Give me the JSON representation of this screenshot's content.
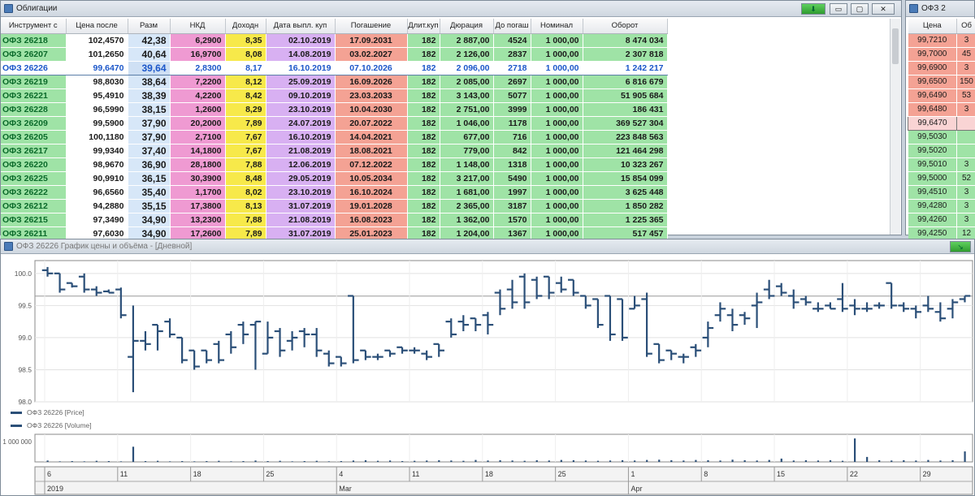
{
  "bonds_window": {
    "title": "Облигации",
    "columns": [
      "Инструмент с",
      "Цена после",
      "Разм",
      "НКД",
      "Доходн",
      "Дата выпл. куп",
      "Погашение",
      "Длит.куп",
      "Дюрация",
      "До погаш",
      "Номинал",
      "Оборот"
    ],
    "rows": [
      [
        "ОФЗ 26218",
        "102,4570",
        "42,38",
        "6,2900",
        "8,35",
        "02.10.2019",
        "17.09.2031",
        "182",
        "2 887,00",
        "4524",
        "1 000,00",
        "8 474 034"
      ],
      [
        "ОФЗ 26207",
        "101,2650",
        "40,64",
        "16,9700",
        "8,08",
        "14.08.2019",
        "03.02.2027",
        "182",
        "2 126,00",
        "2837",
        "1 000,00",
        "2 307 818"
      ],
      [
        "ОФЗ 26226",
        "99,6470",
        "39,64",
        "2,8300",
        "8,17",
        "16.10.2019",
        "07.10.2026",
        "182",
        "2 096,00",
        "2718",
        "1 000,00",
        "1 242 217"
      ],
      [
        "ОФЗ 26219",
        "98,8030",
        "38,64",
        "7,2200",
        "8,12",
        "25.09.2019",
        "16.09.2026",
        "182",
        "2 085,00",
        "2697",
        "1 000,00",
        "6 816 679"
      ],
      [
        "ОФЗ 26221",
        "95,4910",
        "38,39",
        "4,2200",
        "8,42",
        "09.10.2019",
        "23.03.2033",
        "182",
        "3 143,00",
        "5077",
        "1 000,00",
        "51 905 684"
      ],
      [
        "ОФЗ 26228",
        "96,5990",
        "38,15",
        "1,2600",
        "8,29",
        "23.10.2019",
        "10.04.2030",
        "182",
        "2 751,00",
        "3999",
        "1 000,00",
        "186 431"
      ],
      [
        "ОФЗ 26209",
        "99,5900",
        "37,90",
        "20,2000",
        "7,89",
        "24.07.2019",
        "20.07.2022",
        "182",
        "1 046,00",
        "1178",
        "1 000,00",
        "369 527 304"
      ],
      [
        "ОФЗ 26205",
        "100,1180",
        "37,90",
        "2,7100",
        "7,67",
        "16.10.2019",
        "14.04.2021",
        "182",
        "677,00",
        "716",
        "1 000,00",
        "223 848 563"
      ],
      [
        "ОФЗ 26217",
        "99,9340",
        "37,40",
        "14,1800",
        "7,67",
        "21.08.2019",
        "18.08.2021",
        "182",
        "779,00",
        "842",
        "1 000,00",
        "121 464 298"
      ],
      [
        "ОФЗ 26220",
        "98,9670",
        "36,90",
        "28,1800",
        "7,88",
        "12.06.2019",
        "07.12.2022",
        "182",
        "1 148,00",
        "1318",
        "1 000,00",
        "10 323 267"
      ],
      [
        "ОФЗ 26225",
        "90,9910",
        "36,15",
        "30,3900",
        "8,48",
        "29.05.2019",
        "10.05.2034",
        "182",
        "3 217,00",
        "5490",
        "1 000,00",
        "15 854 099"
      ],
      [
        "ОФЗ 26222",
        "96,6560",
        "35,40",
        "1,1700",
        "8,02",
        "23.10.2019",
        "16.10.2024",
        "182",
        "1 681,00",
        "1997",
        "1 000,00",
        "3 625 448"
      ],
      [
        "ОФЗ 26212",
        "94,2880",
        "35,15",
        "17,3800",
        "8,13",
        "31.07.2019",
        "19.01.2028",
        "182",
        "2 365,00",
        "3187",
        "1 000,00",
        "1 850 282"
      ],
      [
        "ОФЗ 26215",
        "97,3490",
        "34,90",
        "13,2300",
        "7,88",
        "21.08.2019",
        "16.08.2023",
        "182",
        "1 362,00",
        "1570",
        "1 000,00",
        "1 225 365"
      ],
      [
        "ОФЗ 26211",
        "97,6030",
        "34,90",
        "17,2600",
        "7,89",
        "31.07.2019",
        "25.01.2023",
        "182",
        "1 204,00",
        "1367",
        "1 000,00",
        "517 457"
      ]
    ],
    "selected_row": 2,
    "toolbar_down_icon": "down-arrow-icon"
  },
  "orderbook_window": {
    "title": "ОФЗ 2",
    "columns": [
      "Цена",
      "Об"
    ],
    "rows": [
      [
        "99,7210",
        "3",
        "sell"
      ],
      [
        "99,7000",
        "45",
        "sell"
      ],
      [
        "99,6900",
        "3",
        "sell"
      ],
      [
        "99,6500",
        "150",
        "sell"
      ],
      [
        "99,6490",
        "53",
        "sell"
      ],
      [
        "99,6480",
        "3",
        "sell"
      ],
      [
        "99,6470",
        "",
        "current"
      ],
      [
        "99,5030",
        "",
        "buy"
      ],
      [
        "99,5020",
        "",
        "buy"
      ],
      [
        "99,5010",
        "3",
        "buy"
      ],
      [
        "99,5000",
        "52",
        "buy"
      ],
      [
        "99,4510",
        "3",
        "buy"
      ],
      [
        "99,4280",
        "3",
        "buy"
      ],
      [
        "99,4260",
        "3",
        "buy"
      ],
      [
        "99,4250",
        "12",
        "buy"
      ]
    ]
  },
  "chart_window": {
    "title": "ОФЗ 26226 График цены и объёма - [Дневной]",
    "legend_price": "ОФЗ 26226 [Price]",
    "legend_volume": "ОФЗ 26226 [Volume]",
    "volume_axis_label": "1 000 000",
    "date_labels": [
      "6",
      "11",
      "18",
      "25",
      "4",
      "11",
      "18",
      "25",
      "1",
      "8",
      "15",
      "22",
      "29"
    ],
    "month_labels": [
      "2019",
      "Mar",
      "Apr"
    ]
  },
  "chart_data": {
    "type": "ohlc",
    "yticks": [
      100.0,
      99.5,
      99.0,
      98.5,
      98.0
    ],
    "ylim": [
      98.0,
      100.2
    ],
    "current_price": 99.647,
    "series": [
      {
        "name": "ОФЗ 26226 [Price]",
        "bars": [
          [
            100.05,
            100.1,
            99.95,
            100.0
          ],
          [
            100.0,
            100.0,
            99.7,
            99.75
          ],
          [
            99.85,
            99.85,
            99.78,
            99.8
          ],
          [
            99.95,
            100.0,
            99.7,
            99.75
          ],
          [
            99.75,
            99.8,
            99.65,
            99.7
          ],
          [
            99.72,
            99.75,
            99.7,
            99.7
          ],
          [
            99.75,
            99.78,
            99.3,
            99.35
          ],
          [
            98.7,
            99.5,
            98.15,
            98.95
          ],
          [
            98.95,
            99.1,
            98.8,
            98.9
          ],
          [
            99.2,
            99.2,
            98.8,
            99.1
          ],
          [
            99.25,
            99.3,
            99.0,
            99.05
          ],
          [
            99.0,
            99.0,
            98.6,
            98.65
          ],
          [
            98.8,
            98.8,
            98.5,
            98.55
          ],
          [
            98.8,
            98.8,
            98.6,
            98.65
          ],
          [
            98.9,
            98.95,
            98.6,
            98.65
          ],
          [
            99.05,
            99.1,
            98.75,
            98.85
          ],
          [
            99.2,
            99.25,
            98.9,
            99.05
          ],
          [
            99.2,
            99.25,
            98.5,
            99.25
          ],
          [
            98.75,
            99.25,
            98.75,
            99.0
          ],
          [
            99.1,
            99.15,
            98.7,
            98.8
          ],
          [
            98.95,
            99.1,
            98.8,
            99.0
          ],
          [
            99.1,
            99.15,
            98.85,
            99.05
          ],
          [
            99.05,
            99.15,
            98.7,
            98.8
          ],
          [
            98.75,
            98.8,
            98.55,
            98.6
          ],
          [
            98.7,
            98.7,
            98.55,
            98.6
          ],
          [
            99.65,
            99.65,
            98.6,
            98.65
          ],
          [
            98.8,
            98.8,
            98.65,
            98.7
          ],
          [
            98.7,
            98.75,
            98.65,
            98.7
          ],
          [
            98.8,
            98.8,
            98.7,
            98.75
          ],
          [
            98.85,
            98.85,
            98.75,
            98.8
          ],
          [
            98.8,
            98.85,
            98.75,
            98.8
          ],
          [
            98.75,
            98.8,
            98.65,
            98.7
          ],
          [
            98.9,
            98.9,
            98.7,
            98.8
          ],
          [
            99.25,
            99.3,
            99.0,
            99.05
          ],
          [
            99.25,
            99.35,
            99.1,
            99.2
          ],
          [
            99.3,
            99.3,
            99.1,
            99.2
          ],
          [
            99.35,
            99.4,
            99.05,
            99.2
          ],
          [
            99.7,
            99.75,
            99.35,
            99.45
          ],
          [
            99.75,
            99.9,
            99.45,
            99.55
          ],
          [
            99.95,
            100.0,
            99.45,
            99.55
          ],
          [
            99.9,
            99.95,
            99.6,
            99.65
          ],
          [
            99.95,
            99.95,
            99.6,
            99.7
          ],
          [
            99.85,
            99.95,
            99.7,
            99.75
          ],
          [
            99.9,
            99.9,
            99.65,
            99.7
          ],
          [
            99.65,
            99.65,
            99.45,
            99.5
          ],
          [
            99.6,
            99.6,
            99.15,
            99.2
          ],
          [
            99.65,
            99.65,
            98.95,
            99.05
          ],
          [
            99.6,
            99.6,
            98.95,
            99.0
          ],
          [
            99.45,
            99.65,
            99.45,
            99.5
          ],
          [
            99.6,
            99.7,
            98.7,
            98.75
          ],
          [
            98.9,
            98.9,
            98.6,
            98.65
          ],
          [
            98.8,
            98.8,
            98.65,
            98.75
          ],
          [
            98.7,
            98.75,
            98.6,
            98.7
          ],
          [
            98.85,
            98.9,
            98.7,
            98.8
          ],
          [
            99.0,
            99.25,
            98.85,
            99.15
          ],
          [
            99.35,
            99.55,
            99.25,
            99.45
          ],
          [
            99.35,
            99.45,
            99.1,
            99.2
          ],
          [
            99.35,
            99.4,
            99.2,
            99.3
          ],
          [
            99.5,
            99.7,
            99.15,
            99.55
          ],
          [
            99.75,
            99.9,
            99.6,
            99.65
          ],
          [
            99.8,
            99.85,
            99.65,
            99.7
          ],
          [
            99.65,
            99.75,
            99.45,
            99.55
          ],
          [
            99.6,
            99.65,
            99.5,
            99.55
          ],
          [
            99.45,
            99.55,
            99.4,
            99.45
          ],
          [
            99.5,
            99.55,
            99.45,
            99.45
          ],
          [
            99.6,
            99.85,
            99.4,
            99.45
          ],
          [
            99.5,
            99.6,
            99.35,
            99.45
          ],
          [
            99.45,
            99.55,
            99.4,
            99.45
          ],
          [
            99.5,
            99.55,
            99.45,
            99.5
          ],
          [
            99.85,
            99.85,
            99.45,
            99.5
          ],
          [
            99.5,
            99.55,
            99.4,
            99.45
          ],
          [
            99.45,
            99.5,
            99.3,
            99.4
          ],
          [
            99.5,
            99.65,
            99.4,
            99.45
          ],
          [
            99.4,
            99.55,
            99.25,
            99.3
          ],
          [
            99.45,
            99.6,
            99.3,
            99.55
          ],
          [
            99.6,
            99.65,
            99.55,
            99.65
          ]
        ]
      },
      {
        "name": "ОФЗ 26226 [Volume]",
        "values": [
          0.05,
          0.02,
          0.03,
          0.02,
          0.04,
          0.03,
          0.02,
          0.55,
          0.03,
          0.04,
          0.02,
          0.03,
          0.02,
          0.03,
          0.04,
          0.02,
          0.03,
          0.05,
          0.03,
          0.04,
          0.02,
          0.03,
          0.04,
          0.02,
          0.03,
          0.05,
          0.06,
          0.04,
          0.05,
          0.03,
          0.04,
          0.05,
          0.06,
          0.05,
          0.04,
          0.07,
          0.05,
          0.06,
          0.05,
          0.04,
          0.06,
          0.05,
          0.07,
          0.06,
          0.05,
          0.04,
          0.05,
          0.06,
          0.05,
          0.07,
          0.08,
          0.06,
          0.05,
          0.07,
          0.06,
          0.05,
          0.08,
          0.06,
          0.05,
          0.07,
          0.12,
          0.05,
          0.06,
          0.05,
          0.06,
          0.04,
          0.85,
          0.18,
          0.06,
          0.05,
          0.06,
          0.05,
          0.07,
          0.05,
          0.06,
          0.38
        ]
      }
    ]
  },
  "colors": {
    "bar": "#2b4f78",
    "price_line": "#999999",
    "accent_green": "#2f9c2f"
  }
}
